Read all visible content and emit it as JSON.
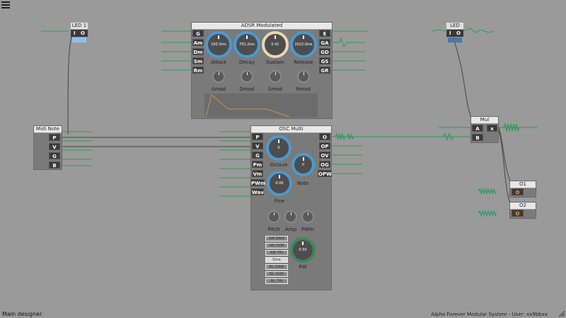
{
  "app": {
    "status_left": "Main designer",
    "status_right": "Alpha Forever Modular System - User: xx9bbxx"
  },
  "led1": {
    "title": "LED 1",
    "io": [
      "I",
      "O"
    ]
  },
  "led2": {
    "title": "LED",
    "io": [
      "I",
      "O"
    ]
  },
  "adsr": {
    "title": "ADSR Modulated",
    "in_ports": [
      "G",
      "Am",
      "Dm",
      "Sm",
      "Rm"
    ],
    "out_ports": [
      "E",
      "GA",
      "GD",
      "GS",
      "GR"
    ],
    "knobs": [
      {
        "label": "Attack",
        "value": "160.3ms"
      },
      {
        "label": "Decay",
        "value": "702.2ms"
      },
      {
        "label": "Sustain",
        "value": "0.41"
      },
      {
        "label": "Release",
        "value": "2022.0ms"
      }
    ],
    "mod_knobs": [
      "Amod",
      "Dmod",
      "Smod",
      "Rmod"
    ]
  },
  "midi": {
    "title": "Midi Note",
    "ports": [
      "P",
      "V",
      "G",
      "B"
    ]
  },
  "osc": {
    "title": "OSC Multi",
    "in_ports": [
      "P",
      "V",
      "G",
      "Pm",
      "Vm",
      "PWm",
      "Wav"
    ],
    "out_ports": [
      "O",
      "OP",
      "OV",
      "OG",
      "OPW"
    ],
    "knobs": [
      {
        "label": "Octave",
        "value": "0"
      },
      {
        "label": "Note",
        "value": "0"
      },
      {
        "label": "Fine",
        "value": "0.00"
      },
      {
        "label": "PW",
        "value": "0.50"
      }
    ],
    "small_knobs": [
      "Pitch",
      "Amp",
      "PWm"
    ],
    "waveforms": [
      "AN SAW",
      "AN SQR",
      "AN TRI",
      "Sine",
      "BL SAW",
      "BL SQR",
      "BL TRI"
    ],
    "selected_waveform": "Sine"
  },
  "mul": {
    "title": "Mul",
    "in_ports": [
      "A",
      "B"
    ],
    "out_port": "x"
  },
  "o1": {
    "title": "O1",
    "port": "O"
  },
  "o2": {
    "title": "O2",
    "port": "O"
  },
  "colors": {
    "background": "#9a9a9a",
    "module": "#7a7a7a",
    "wire": "#2a9a60",
    "knob_ring": "#4a9ad0",
    "sustain_ring": "#e8d8b0",
    "led1_fill": "#8fc0e8",
    "led2_fill": "#4a78a8",
    "envelope": "#d09040"
  }
}
